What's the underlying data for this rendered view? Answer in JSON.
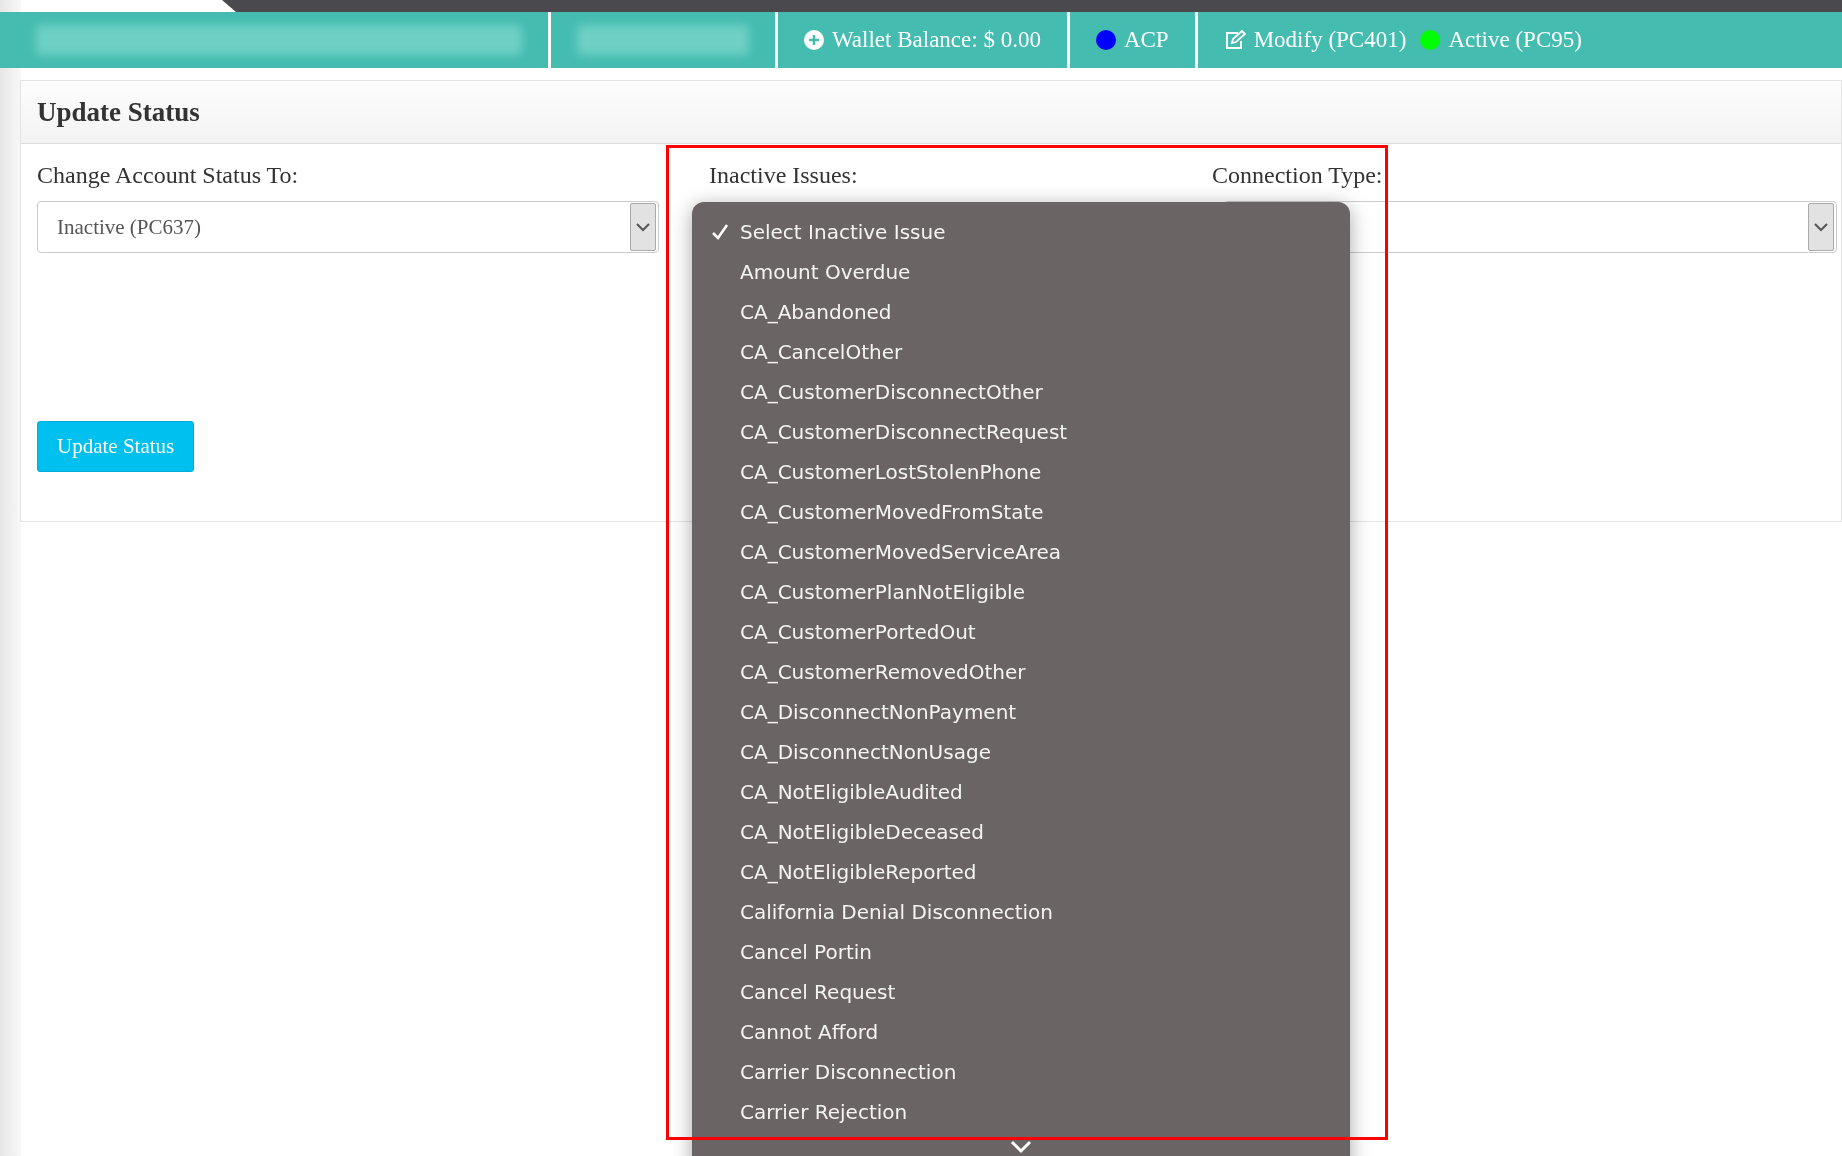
{
  "top_bar": {
    "groups": [
      {
        "items": [
          {
            "kind": "redacted"
          }
        ]
      },
      {
        "items": [
          {
            "kind": "redacted"
          }
        ]
      },
      {
        "items": [
          {
            "kind": "wallet",
            "text": "Wallet Balance: $ 0.00"
          }
        ]
      },
      {
        "items": [
          {
            "kind": "status",
            "text": "ACP",
            "color": "#0000ff"
          }
        ]
      },
      {
        "items": [
          {
            "kind": "modify",
            "text": "Modify (PC401)"
          },
          {
            "kind": "status",
            "text": "Active (PC95)",
            "color": "#00ff00"
          }
        ]
      }
    ]
  },
  "panel": {
    "title": "Update Status",
    "account_status": {
      "label": "Change Account Status To:",
      "value": "Inactive (PC637)"
    },
    "inactive_issues": {
      "label": "Inactive Issues:"
    },
    "connection_type": {
      "label": "Connection Type:"
    },
    "button": "Update Status"
  },
  "dropdown": {
    "options": [
      {
        "text": "Select Inactive Issue",
        "selected": true
      },
      {
        "text": "Amount Overdue",
        "selected": false
      },
      {
        "text": "CA_Abandoned",
        "selected": false
      },
      {
        "text": "CA_CancelOther",
        "selected": false
      },
      {
        "text": "CA_CustomerDisconnectOther",
        "selected": false
      },
      {
        "text": "CA_CustomerDisconnectRequest",
        "selected": false
      },
      {
        "text": "CA_CustomerLostStolenPhone",
        "selected": false
      },
      {
        "text": "CA_CustomerMovedFromState",
        "selected": false
      },
      {
        "text": "CA_CustomerMovedServiceArea",
        "selected": false
      },
      {
        "text": "CA_CustomerPlanNotEligible",
        "selected": false
      },
      {
        "text": "CA_CustomerPortedOut",
        "selected": false
      },
      {
        "text": "CA_CustomerRemovedOther",
        "selected": false
      },
      {
        "text": "CA_DisconnectNonPayment",
        "selected": false
      },
      {
        "text": "CA_DisconnectNonUsage",
        "selected": false
      },
      {
        "text": "CA_NotEligibleAudited",
        "selected": false
      },
      {
        "text": "CA_NotEligibleDeceased",
        "selected": false
      },
      {
        "text": "CA_NotEligibleReported",
        "selected": false
      },
      {
        "text": "California Denial Disconnection",
        "selected": false
      },
      {
        "text": "Cancel Portin",
        "selected": false
      },
      {
        "text": "Cancel Request",
        "selected": false
      },
      {
        "text": "Cannot Afford",
        "selected": false
      },
      {
        "text": "Carrier Disconnection",
        "selected": false
      },
      {
        "text": "Carrier Rejection",
        "selected": false
      }
    ]
  }
}
